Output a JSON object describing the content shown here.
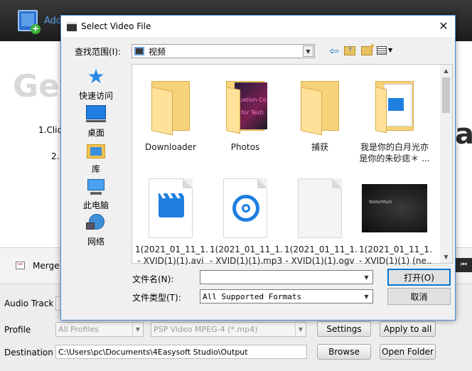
{
  "app": {
    "toolbar": {
      "add_label": "Add"
    },
    "main": {
      "faint_heading": "Gett",
      "step1": "1.Clic",
      "step2": "2.",
      "faint_right": "as"
    },
    "merge_label": "Merge",
    "labels": {
      "audio_track": "Audio Track",
      "profile": "Profile",
      "destination": "Destination"
    },
    "profile_select": "All Profiles",
    "format_select": "PSP Video MPEG-4 (*.mp4)",
    "destination_path": "C:\\Users\\pc\\Documents\\4Easysoft Studio\\Output",
    "buttons": {
      "settings": "Settings",
      "apply_to_all": "Apply to all",
      "browse": "Browse",
      "open_folder": "Open Folder"
    }
  },
  "dialog": {
    "title": "Select Video File",
    "lookin_label": "查找范围(I):",
    "lookin_value": "视频",
    "places": [
      {
        "label": "快速访问",
        "icon": "star-icon"
      },
      {
        "label": "桌面",
        "icon": "desktop-icon"
      },
      {
        "label": "库",
        "icon": "library-icon"
      },
      {
        "label": "此电脑",
        "icon": "computer-icon"
      },
      {
        "label": "网络",
        "icon": "network-icon"
      }
    ],
    "files": [
      {
        "line1": "Downloader",
        "line2": "",
        "kind": "folder"
      },
      {
        "line1": "Photos",
        "line2": "",
        "kind": "photo-folder"
      },
      {
        "line1": "捕获",
        "line2": "",
        "kind": "folder"
      },
      {
        "line1": "我是你的白月光亦",
        "line2": "是你的朱砂痣＊ ...",
        "kind": "video-folder"
      },
      {
        "line1": "1(2021_01_11_1...",
        "line2": "- XVID(1)(1).avi",
        "kind": "video"
      },
      {
        "line1": "1(2021_01_11_1...",
        "line2": "- XVID(1)(1).mp3",
        "kind": "audio"
      },
      {
        "line1": "1(2021_01_11_1...",
        "line2": "- XVID(1)(1).ogv",
        "kind": "blank"
      },
      {
        "line1": "1(2021_01_11_1...",
        "line2": "- XVID(1)(1) (ne...",
        "kind": "thumbnail"
      }
    ],
    "photo_overlay": {
      "line1": "luation Co",
      "line2": "y for Testi"
    },
    "video_thumb_text": "WaterMark",
    "filename_label": "文件名(N):",
    "filename_value": "",
    "filetype_label": "文件类型(T):",
    "filetype_value": "All Supported Formats",
    "open_button": "打开(O)",
    "cancel_button": "取消"
  }
}
